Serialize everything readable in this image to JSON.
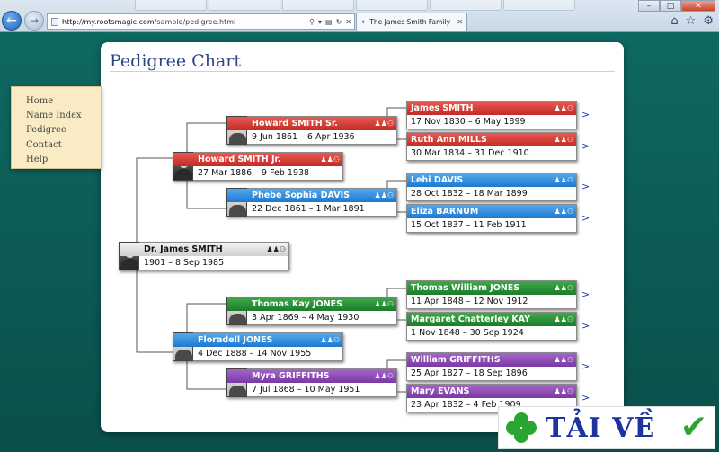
{
  "browser": {
    "url_host": "http://my.rootsmagic.com",
    "url_path": "/sample/pedigree.html",
    "tab_title": "The James Smith Family (A ...",
    "win_minimize": "–",
    "win_maximize": "□",
    "win_close": "✕"
  },
  "sidebar": {
    "items": [
      {
        "label": "Home"
      },
      {
        "label": "Name Index"
      },
      {
        "label": "Pedigree"
      },
      {
        "label": "Contact"
      },
      {
        "label": "Help"
      }
    ]
  },
  "page": {
    "title": "Pedigree Chart"
  },
  "icons_text": "♟♟⚇",
  "more_glyph": ">",
  "people": {
    "root": {
      "name": "Dr. James SMITH",
      "dates": "1901 – 8 Sep 1985",
      "color": "gray"
    },
    "f": {
      "name": "Howard SMITH Jr.",
      "dates": "27 Mar 1886 – 9 Feb 1938",
      "color": "red"
    },
    "m": {
      "name": "Floradell JONES",
      "dates": "4 Dec 1888 – 14 Nov 1955",
      "color": "blue"
    },
    "ff": {
      "name": "Howard SMITH Sr.",
      "dates": "9 Jun 1861 – 6 Apr 1936",
      "color": "red"
    },
    "fm": {
      "name": "Phebe Sophia DAVIS",
      "dates": "22 Dec 1861 – 1 Mar 1891",
      "color": "blue"
    },
    "mf": {
      "name": "Thomas Kay JONES",
      "dates": "3 Apr 1869 – 4 May 1930",
      "color": "green"
    },
    "mm": {
      "name": "Myra GRIFFITHS",
      "dates": "7 Jul 1868 – 10 May 1951",
      "color": "purple"
    },
    "fff": {
      "name": "James SMITH",
      "dates": "17 Nov 1830 – 6 May 1899",
      "color": "red"
    },
    "ffm": {
      "name": "Ruth Ann MILLS",
      "dates": "30 Mar 1834 – 31 Dec 1910",
      "color": "red"
    },
    "fmf": {
      "name": "Lehi DAVIS",
      "dates": "28 Oct 1832 – 18 Mar 1899",
      "color": "blue"
    },
    "fmm": {
      "name": "Eliza BARNUM",
      "dates": "15 Oct 1837 – 11 Feb 1911",
      "color": "blue"
    },
    "mff": {
      "name": "Thomas William JONES",
      "dates": "11 Apr 1848 – 12 Nov 1912",
      "color": "green"
    },
    "mfm": {
      "name": "Margaret Chatterley KAY",
      "dates": "1 Nov 1848 – 30 Sep 1924",
      "color": "green"
    },
    "mmf": {
      "name": "William GRIFFITHS",
      "dates": "25 Apr 1827 – 18 Sep 1896",
      "color": "purple"
    },
    "mmm": {
      "name": "Mary EVANS",
      "dates": "23 Apr 1832 – 4 Feb 1909",
      "color": "purple"
    }
  },
  "watermark": {
    "text": "TẢI VỀ"
  }
}
